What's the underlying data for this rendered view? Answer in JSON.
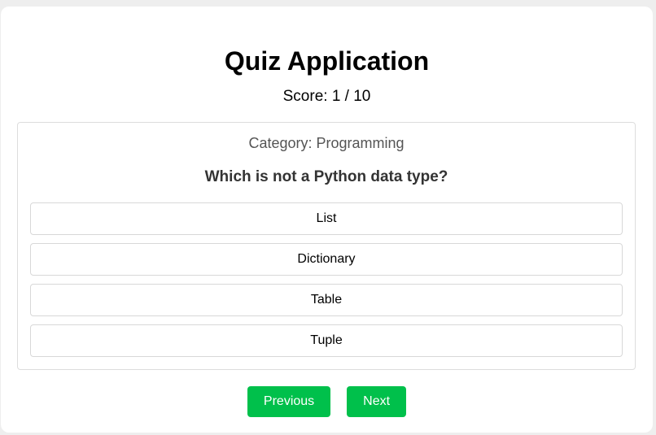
{
  "app": {
    "title": "Quiz Application"
  },
  "score": {
    "label": "Score: 1 / 10"
  },
  "question": {
    "category": "Category: Programming",
    "text": "Which is not a Python data type?",
    "options": [
      "List",
      "Dictionary",
      "Table",
      "Tuple"
    ]
  },
  "navigation": {
    "previous_label": "Previous",
    "next_label": "Next"
  },
  "colors": {
    "accent": "#00c04b",
    "background": "#eeeeee",
    "card": "#ffffff"
  }
}
